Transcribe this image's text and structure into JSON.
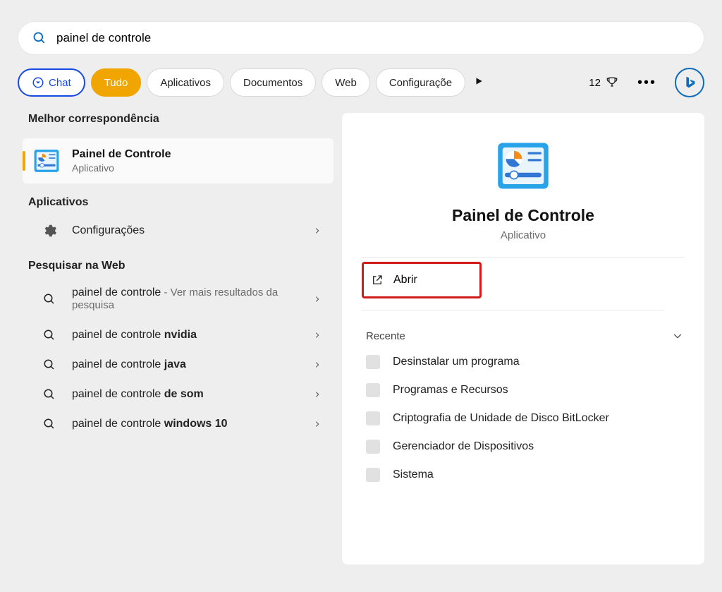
{
  "search": {
    "value": "painel de controle"
  },
  "tabs": {
    "chat": "Chat",
    "all": "Tudo",
    "apps": "Aplicativos",
    "docs": "Documentos",
    "web": "Web",
    "settings": "Configuraçõe"
  },
  "points_count": "12",
  "left": {
    "best_match_header": "Melhor correspondência",
    "best_match_title": "Painel de Controle",
    "best_match_subtitle": "Aplicativo",
    "apps_header": "Aplicativos",
    "config_label": "Configurações",
    "web_header": "Pesquisar na Web",
    "web_items": [
      {
        "prefix": "painel de controle",
        "bold": "",
        "suffix": " - Ver mais resultados da pesquisa"
      },
      {
        "prefix": "painel de controle ",
        "bold": "nvidia",
        "suffix": ""
      },
      {
        "prefix": "painel de controle ",
        "bold": "java",
        "suffix": ""
      },
      {
        "prefix": "painel de controle ",
        "bold": "de som",
        "suffix": ""
      },
      {
        "prefix": "painel de controle ",
        "bold": "windows 10",
        "suffix": ""
      }
    ]
  },
  "detail": {
    "title": "Painel de Controle",
    "subtitle": "Aplicativo",
    "open_label": "Abrir",
    "recent_header": "Recente",
    "recent": [
      "Desinstalar um programa",
      "Programas e Recursos",
      "Criptografia de Unidade de Disco BitLocker",
      "Gerenciador de Dispositivos",
      "Sistema"
    ]
  }
}
